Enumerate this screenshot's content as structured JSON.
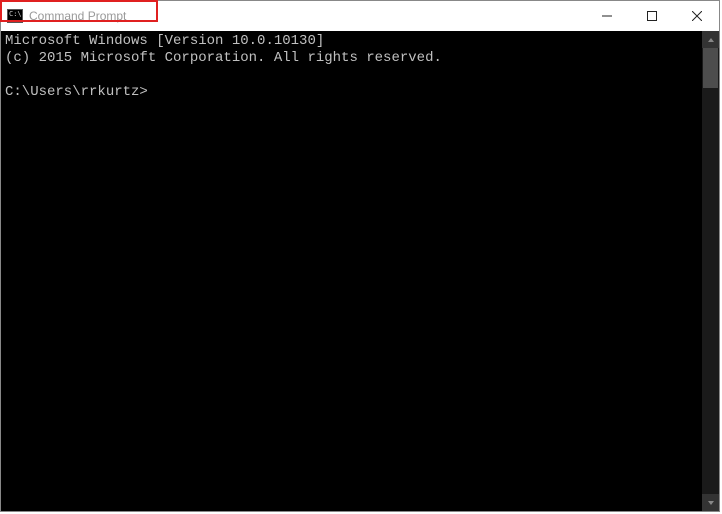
{
  "titlebar": {
    "icon_text": "C:\\",
    "title": "Command Prompt"
  },
  "terminal": {
    "line1": "Microsoft Windows [Version 10.0.10130]",
    "line2": "(c) 2015 Microsoft Corporation. All rights reserved.",
    "blank": "",
    "prompt": "C:\\Users\\rrkurtz>"
  }
}
